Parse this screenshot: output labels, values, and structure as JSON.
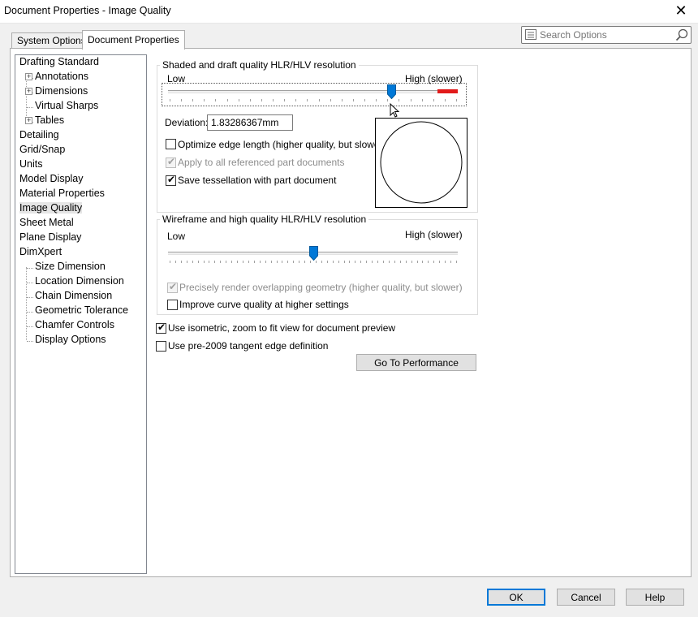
{
  "window": {
    "title": "Document Properties - Image Quality",
    "close_glyph": "✕"
  },
  "tabs": [
    {
      "label": "System Options"
    },
    {
      "label": "Document Properties"
    }
  ],
  "search": {
    "placeholder": "Search Options"
  },
  "tree": {
    "items": [
      {
        "label": "Drafting Standard"
      },
      {
        "label": "Annotations",
        "expandable": true
      },
      {
        "label": "Dimensions",
        "expandable": true
      },
      {
        "label": "Virtual Sharps"
      },
      {
        "label": "Tables",
        "expandable": true
      },
      {
        "label": "Detailing"
      },
      {
        "label": "Grid/Snap"
      },
      {
        "label": "Units"
      },
      {
        "label": "Model Display"
      },
      {
        "label": "Material Properties"
      },
      {
        "label": "Image Quality",
        "selected": true
      },
      {
        "label": "Sheet Metal"
      },
      {
        "label": "Plane Display"
      },
      {
        "label": "DimXpert"
      },
      {
        "label": "Size Dimension"
      },
      {
        "label": "Location Dimension"
      },
      {
        "label": "Chain Dimension"
      },
      {
        "label": "Geometric Tolerance"
      },
      {
        "label": "Chamfer Controls"
      },
      {
        "label": "Display Options"
      }
    ]
  },
  "shaded": {
    "legend": "Shaded and draft quality HLR/HLV resolution",
    "low": "Low",
    "high": "High (slower)",
    "slider_fraction": 0.77,
    "deviation_label": "Deviation:",
    "deviation_value": "1.83286367mm",
    "optimize_label": "Optimize edge length (higher quality, but slower)",
    "optimize_checked": false,
    "apply_label": "Apply to all referenced part documents",
    "apply_checked": true,
    "apply_disabled": true,
    "save_tess_label": "Save tessellation with part document",
    "save_tess_checked": true,
    "accent_red": "#e21a1a"
  },
  "wireframe": {
    "legend": "Wireframe and high quality HLR/HLV resolution",
    "low": "Low",
    "high": "High (slower)",
    "slider_fraction": 0.5,
    "precise_label": "Precisely render overlapping geometry (higher quality, but slower)",
    "precise_checked": true,
    "precise_disabled": true,
    "improve_label": "Improve curve quality at higher settings",
    "improve_checked": false
  },
  "isometric": {
    "label": "Use isometric, zoom to fit view for document preview",
    "checked": true
  },
  "pre2009": {
    "label": "Use pre-2009 tangent edge definition",
    "checked": false
  },
  "go_perf": {
    "label": "Go To Performance"
  },
  "buttons": {
    "ok": "OK",
    "cancel": "Cancel",
    "help": "Help"
  },
  "accent": "#0078d7"
}
